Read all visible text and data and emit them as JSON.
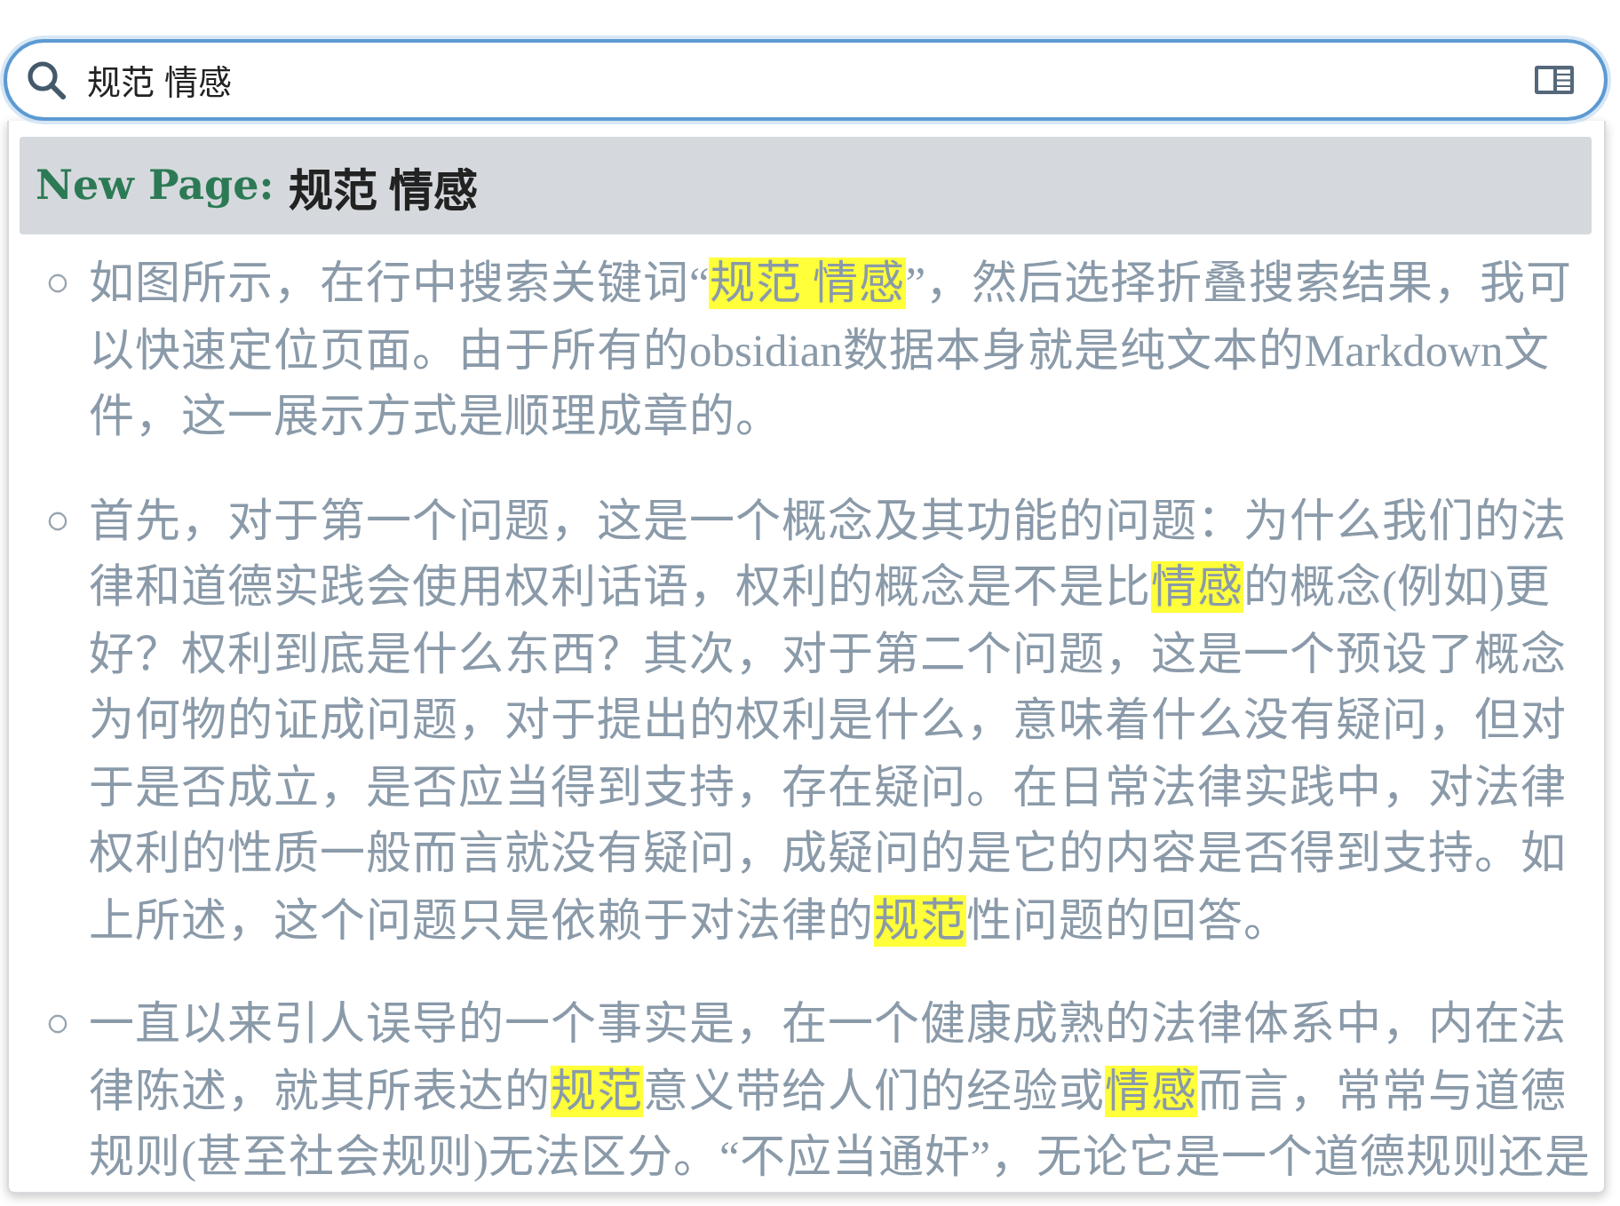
{
  "search": {
    "value": "规范 情感"
  },
  "results": {
    "header": {
      "label": "New Page:",
      "query": "规范 情感"
    },
    "items": [
      {
        "segments": [
          {
            "text": "如图所示，在行中搜索关键词“",
            "highlighted": false
          },
          {
            "text": "规范 情感",
            "highlighted": true
          },
          {
            "text": "”，然后选择折叠搜索结果，我可以快速定位页面。由于所有的obsidian数据本身就是纯文本的Markdown文件，这一展示方式是顺理成章的。",
            "highlighted": false
          }
        ]
      },
      {
        "segments": [
          {
            "text": "首先，对于第一个问题，这是一个概念及其功能的问题：为什么我们的法律和道德实践会使用权利话语，权利的概念是不是比",
            "highlighted": false
          },
          {
            "text": "情感",
            "highlighted": true
          },
          {
            "text": "的概念(例如)更好？权利到底是什么东西？其次，对于第二个问题，这是一个预设了概念为何物的证成问题，对于提出的权利是什么，意味着什么没有疑问，但对于是否成立，是否应当得到支持，存在疑问。在日常法律实践中，对法律权利的性质一般而言就没有疑问，成疑问的是它的内容是否得到支持。如上所述，这个问题只是依赖于对法律的",
            "highlighted": false
          },
          {
            "text": "规范",
            "highlighted": true
          },
          {
            "text": "性问题的回答。",
            "highlighted": false
          }
        ]
      },
      {
        "segments": [
          {
            "text": "一直以来引人误导的一个事实是，在一个健康成熟的法律体系中，内在法律陈述，就其所表达的",
            "highlighted": false
          },
          {
            "text": "规范",
            "highlighted": true
          },
          {
            "text": "意义带给人们的经验或",
            "highlighted": false
          },
          {
            "text": "情感",
            "highlighted": true
          },
          {
            "text": "而言，常常与道德规则(甚至社会规则)无法区分。“不应当通奸”，无论它是一个道德规则还是",
            "highlighted": false
          }
        ]
      }
    ]
  }
}
